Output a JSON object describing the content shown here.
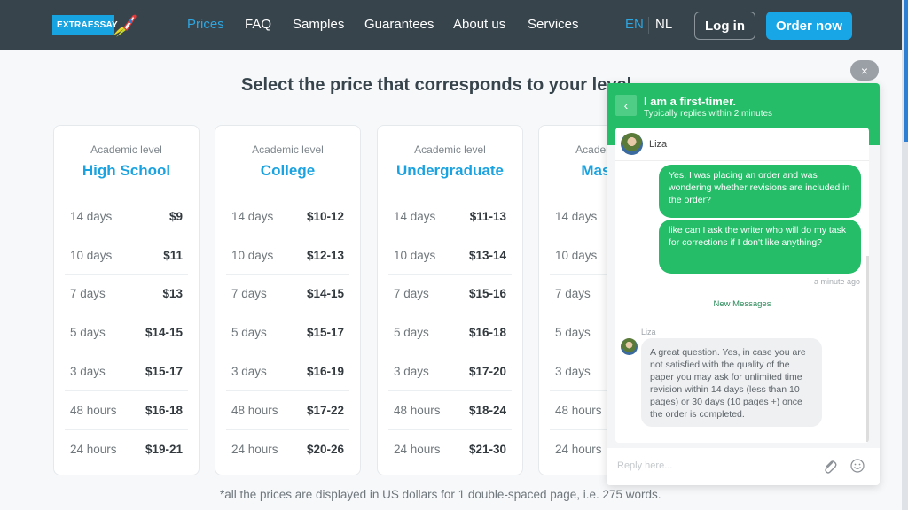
{
  "header": {
    "logo_text": "EXTRAESSAY",
    "nav": [
      {
        "label": "Prices",
        "active": true
      },
      {
        "label": "FAQ",
        "active": false
      },
      {
        "label": "Samples",
        "active": false
      },
      {
        "label": "Guarantees",
        "active": false
      },
      {
        "label": "About us",
        "active": false
      },
      {
        "label": "Services",
        "active": false
      }
    ],
    "lang_en": "EN",
    "lang_nl": "NL",
    "login_label": "Log in",
    "order_label": "Order now"
  },
  "main": {
    "title": "Select the price that corresponds to your level",
    "footnote": "*all the prices are displayed in US dollars for 1 double-spaced page, i.e. 275 words.",
    "cards": [
      {
        "sublabel": "Academic level",
        "level": "High School",
        "rows": [
          {
            "deadline": "14 days",
            "price": "$9"
          },
          {
            "deadline": "10 days",
            "price": "$11"
          },
          {
            "deadline": "7 days",
            "price": "$13"
          },
          {
            "deadline": "5 days",
            "price": "$14-15"
          },
          {
            "deadline": "3 days",
            "price": "$15-17"
          },
          {
            "deadline": "48 hours",
            "price": "$16-18"
          },
          {
            "deadline": "24 hours",
            "price": "$19-21"
          }
        ]
      },
      {
        "sublabel": "Academic level",
        "level": "College",
        "rows": [
          {
            "deadline": "14 days",
            "price": "$10-12"
          },
          {
            "deadline": "10 days",
            "price": "$12-13"
          },
          {
            "deadline": "7 days",
            "price": "$14-15"
          },
          {
            "deadline": "5 days",
            "price": "$15-17"
          },
          {
            "deadline": "3 days",
            "price": "$16-19"
          },
          {
            "deadline": "48 hours",
            "price": "$17-22"
          },
          {
            "deadline": "24 hours",
            "price": "$20-26"
          }
        ]
      },
      {
        "sublabel": "Academic level",
        "level": "Undergraduate",
        "rows": [
          {
            "deadline": "14 days",
            "price": "$11-13"
          },
          {
            "deadline": "10 days",
            "price": "$13-14"
          },
          {
            "deadline": "7 days",
            "price": "$15-16"
          },
          {
            "deadline": "5 days",
            "price": "$16-18"
          },
          {
            "deadline": "3 days",
            "price": "$17-20"
          },
          {
            "deadline": "48 hours",
            "price": "$18-24"
          },
          {
            "deadline": "24 hours",
            "price": "$21-30"
          }
        ]
      },
      {
        "sublabel": "Academic level",
        "level": "Master's",
        "rows": [
          {
            "deadline": "14 days",
            "price": ""
          },
          {
            "deadline": "10 days",
            "price": ""
          },
          {
            "deadline": "7 days",
            "price": ""
          },
          {
            "deadline": "5 days",
            "price": ""
          },
          {
            "deadline": "3 days",
            "price": ""
          },
          {
            "deadline": "48 hours",
            "price": ""
          },
          {
            "deadline": "24 hours",
            "price": ""
          }
        ]
      }
    ]
  },
  "chat": {
    "close_icon": "×",
    "back_icon": "‹",
    "title": "I am a first-timer.",
    "subtitle": "Typically replies within 2 minutes",
    "agent_name": "Liza",
    "messages_out": [
      "Yes, I was placing an order and was wondering whether revisions are included in the order?",
      "like can I ask the writer who will do my task for corrections if I don't like anything?"
    ],
    "timestamp": "a minute ago",
    "new_messages_label": "New Messages",
    "incoming_name": "Liza",
    "message_in": "A great question. Yes, in case you are not satisfied with the quality of the paper you may ask for unlimited time revision within 14 days (less than 10 pages) or 30 days (10 pages +) once the order is completed.",
    "reply_placeholder": "Reply here...",
    "colors": {
      "header": "#26bd69",
      "bubble_out": "#26bd69"
    }
  }
}
